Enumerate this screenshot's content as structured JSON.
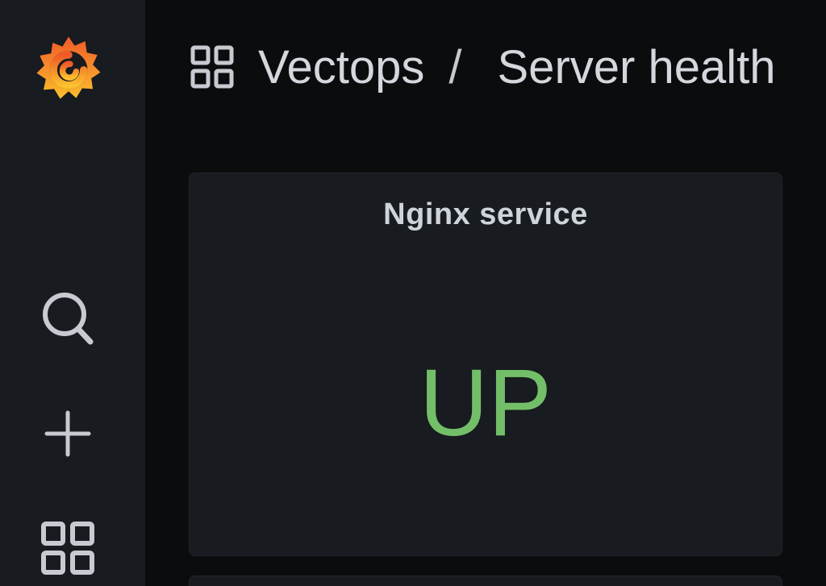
{
  "sidebar": {
    "logo_icon": "grafana-logo",
    "items": [
      {
        "icon": "search-icon"
      },
      {
        "icon": "plus-icon"
      },
      {
        "icon": "dashboards-icon"
      }
    ]
  },
  "breadcrumb": {
    "icon": "dashboards-icon",
    "folder": "Vectops",
    "separator": "/",
    "dashboard": "Server health"
  },
  "panel": {
    "title": "Nginx service",
    "value": "UP",
    "value_color": "#73bf69"
  },
  "colors": {
    "background": "#0b0c0e",
    "sidebar": "#181b1f",
    "panel": "#181b1f",
    "text": "#d4d7dd",
    "status_ok": "#73bf69"
  }
}
